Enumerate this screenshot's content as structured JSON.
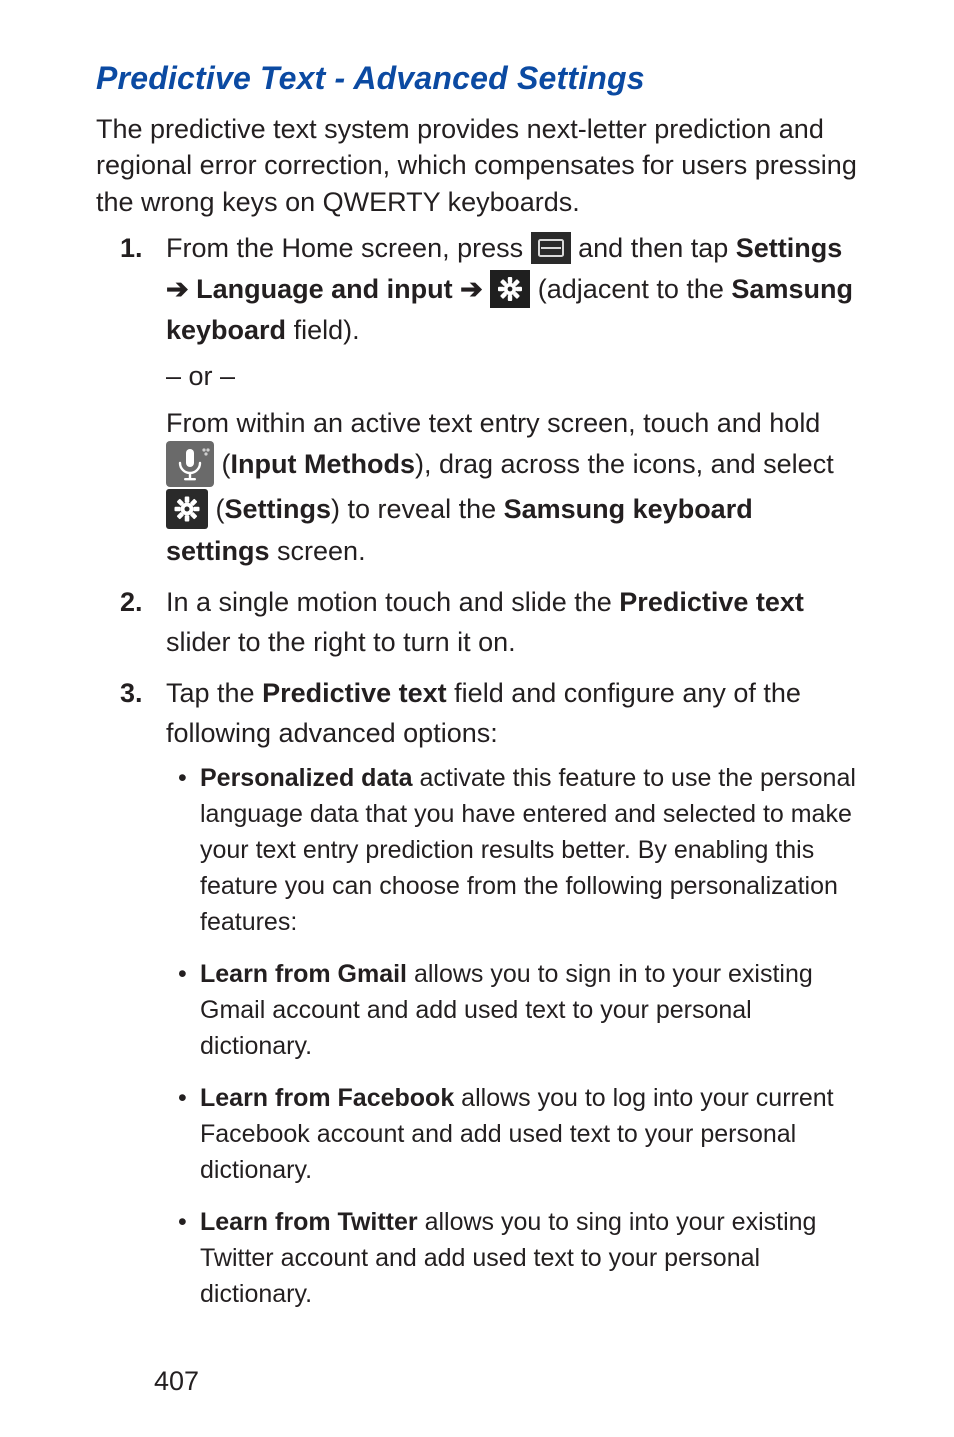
{
  "title": "Predictive Text - Advanced Settings",
  "intro": "The predictive text system provides next-letter prediction and regional error correction, which compensates for users pressing the wrong keys on QWERTY keyboards.",
  "steps": {
    "s1": {
      "num": "1.",
      "t1": "From the Home screen, press ",
      "t2": " and then tap ",
      "settings": "Settings",
      "arrow1": " ➔ ",
      "lang": "Language and input",
      "arrow2": " ➔  ",
      "t3": " (adjacent to the ",
      "samkb": "Samsung keyboard",
      "t4": " field).",
      "or": "– or –",
      "alt_t1": "From within an active text entry screen, touch and hold ",
      "alt_open": "(",
      "alt_im": "Input Methods",
      "alt_t2": "), drag across the icons, and select ",
      "alt_open2": "(",
      "alt_set": "Settings",
      "alt_t3": ") to reveal the ",
      "alt_sks": "Samsung keyboard settings",
      "alt_t4": " screen."
    },
    "s2": {
      "num": "2.",
      "t1": "In a single motion touch and slide the ",
      "pt": "Predictive text",
      "t2": " slider to the right to turn it on."
    },
    "s3": {
      "num": "3.",
      "t1": "Tap the ",
      "pt": "Predictive text",
      "t2": " field and configure any of the following advanced options:"
    }
  },
  "bullets": {
    "b1": {
      "lead": "Personalized data",
      "rest": " activate this feature to use the personal language data that you have entered and selected to make your text entry prediction results better. By enabling this feature you can choose from the following personalization features:"
    },
    "b2": {
      "lead": "Learn from Gmail",
      "rest": " allows you to sign in to your existing Gmail account and add used text to your personal dictionary."
    },
    "b3": {
      "lead": "Learn from Facebook",
      "rest": " allows you to log into your current Facebook account and add used text to your personal dictionary."
    },
    "b4": {
      "lead": "Learn from Twitter",
      "rest": " allows you to sing into your existing Twitter account and add used text to your personal dictionary."
    }
  },
  "page_number": "407"
}
